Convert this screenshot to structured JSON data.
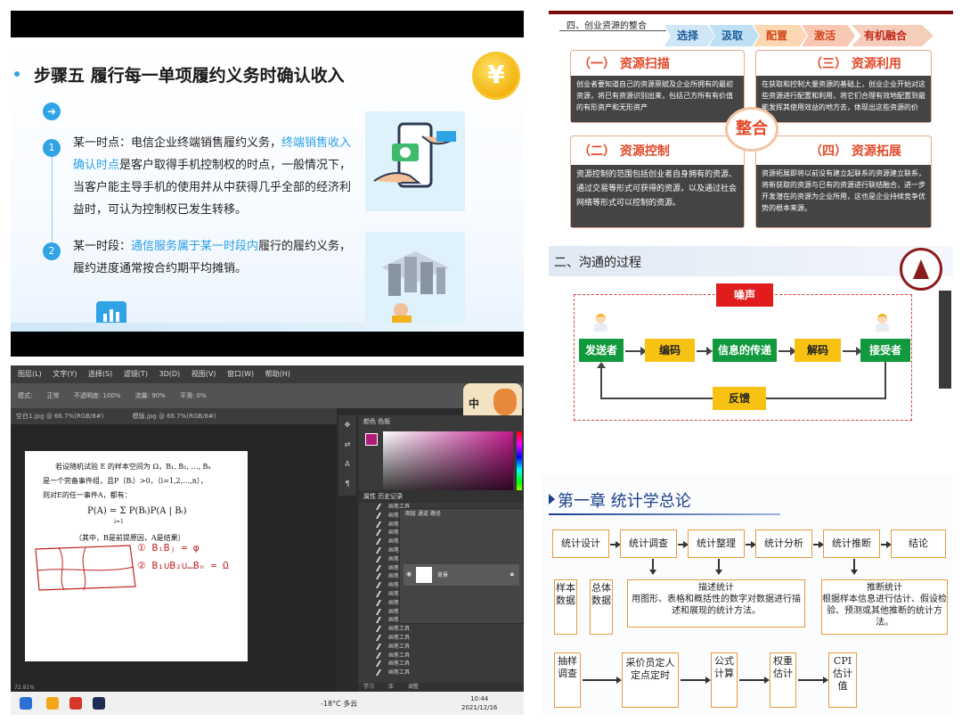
{
  "panel_revenue": {
    "title": "步骤五 履行每一单项履约义务时确认收入",
    "coin_symbol": "¥",
    "item1_number": "1",
    "item1_prefix": "某一时点：电信企业终端销售履约义务，",
    "item1_highlight": "终端销售收入确认时点",
    "item1_rest": "是客户取得手机控制权的时点，一般情况下，当客户能主导手机的使用并从中获得几乎全部的经济利益时，可认为控制权已发生转移。",
    "item2_number": "2",
    "item2_prefix": "某一时段：",
    "item2_highlight": "通信服务属于某一时段内",
    "item2_rest": "履行的履约义务，履约进度通常按合约期平均摊销。"
  },
  "panel_photoshop": {
    "menu": [
      "图层(L)",
      "文字(Y)",
      "选择(S)",
      "滤镜(T)",
      "3D(D)",
      "视图(V)",
      "窗口(W)",
      "帮助(H)"
    ],
    "options": [
      "模式:",
      "正常",
      "不透明度: 100%",
      "流量: 90%",
      "平滑: 0%"
    ],
    "tabs": [
      "空白1.jpg @ 66.7%(RGB/8#)",
      "模版.jpg @ 66.7%(RGB/8#)"
    ],
    "doc_line1": "若设随机试验 E 的样本空间为 Ω，B₁, B₂, …, Bₙ",
    "doc_line2": "是一个完备事件组，且P（Bᵢ）>0，（i=1,2,…,n），",
    "doc_line3": "则对E的任一事件A，都有：",
    "doc_formula": "P(A) = Σ P(Bᵢ)P(A | Bᵢ)",
    "doc_sum_limits": "i=1",
    "doc_note": "（其中，B是前提原因，A是结果）",
    "hand1": "① BᵢBⱼ = φ",
    "hand2": "② B₁∪B₂∪…Bₙ = Ω",
    "mascot_text": "中",
    "color_tabs": "颜色  色板",
    "history_tabs": "属性  历史记录",
    "history_rows": [
      "画笔工具",
      "画笔工具",
      "画笔工具",
      "画笔工具",
      "画笔工具",
      "画笔工具",
      "画笔工具",
      "画笔工具",
      "画笔工具",
      "画笔工具",
      "画笔工具",
      "画笔工具",
      "画笔工具",
      "画笔工具",
      "画笔工具",
      "画笔工具",
      "画笔工具",
      "画笔工具",
      "画笔工具",
      "画笔工具"
    ],
    "layers_tabs": "图层  通道  路径",
    "layer_name": "背景",
    "bottom_tabs": [
      "学习",
      "库",
      "调整"
    ],
    "zoom": "72.91%",
    "weather": "-18°C 多云",
    "time": "10:44",
    "date": "2021/12/16"
  },
  "panel_resources": {
    "header": "四、创业资源的整合",
    "steps": [
      "选择",
      "汲取",
      "配置",
      "激活",
      "有机融合"
    ],
    "center": "整合",
    "cards": [
      {
        "title": "（一） 资源扫描",
        "body": "创业者要知道自己的资源禀赋及企业所拥有的最初资源，将已有资源识别出来，包括己方所有有价值的有形资产和无形资产"
      },
      {
        "title": "（三） 资源利用",
        "body": "在获取和控制大量资源的基础上，创业企业开始对这些资源进行配置和利用，将它们合理有效地配置到最能发挥其使用效益的地方去，体现出这些资源的价值。"
      },
      {
        "title": "（二） 资源控制",
        "body": "资源控制的范围包括创业者自身拥有的资源、通过交易等形式可获得的资源，以及通过社会网络等形式可以控制的资源。"
      },
      {
        "title": "（四） 资源拓展",
        "body": "资源拓展即将以前没有建立起联系的资源建立联系，将新获取的资源与已有的资源进行联结融合，进一步开发潜在的资源为企业所用，这也是企业持续竞争优势的根本来源。"
      }
    ]
  },
  "panel_communication": {
    "title": "二、沟通的过程",
    "noise": "噪声",
    "sender": "发送者",
    "encode": "编码",
    "transmit": "信息的传递",
    "decode": "解码",
    "receiver": "接受者",
    "feedback": "反馈"
  },
  "panel_statistics": {
    "title": "第一章  统计学总论",
    "flow": [
      "统计设计",
      "统计调查",
      "统计整理",
      "统计分析",
      "统计推断",
      "结论"
    ],
    "population_labels": [
      "样本数据",
      "总体数据"
    ],
    "descriptive_title": "描述统计",
    "descriptive_body": "用图形、表格和概括性的数字对数据进行描述和展现的统计方法。",
    "inferential_title": "推断统计",
    "inferential_body": "根据样本信息进行估计、假设检验、预测或其他推断的统计方法。",
    "cpi_flow": [
      "抽样调查",
      "采价员定人定点定时",
      "公式计算",
      "权重估计",
      "CPI估计值"
    ]
  },
  "colors": {
    "blue_accent": "#2fa3e6",
    "red_title": "#e34a2a",
    "green_box": "#119a3d",
    "yellow_box": "#f7c212",
    "orange_border": "#e89a3a",
    "navy_title": "#1c3f8c"
  }
}
